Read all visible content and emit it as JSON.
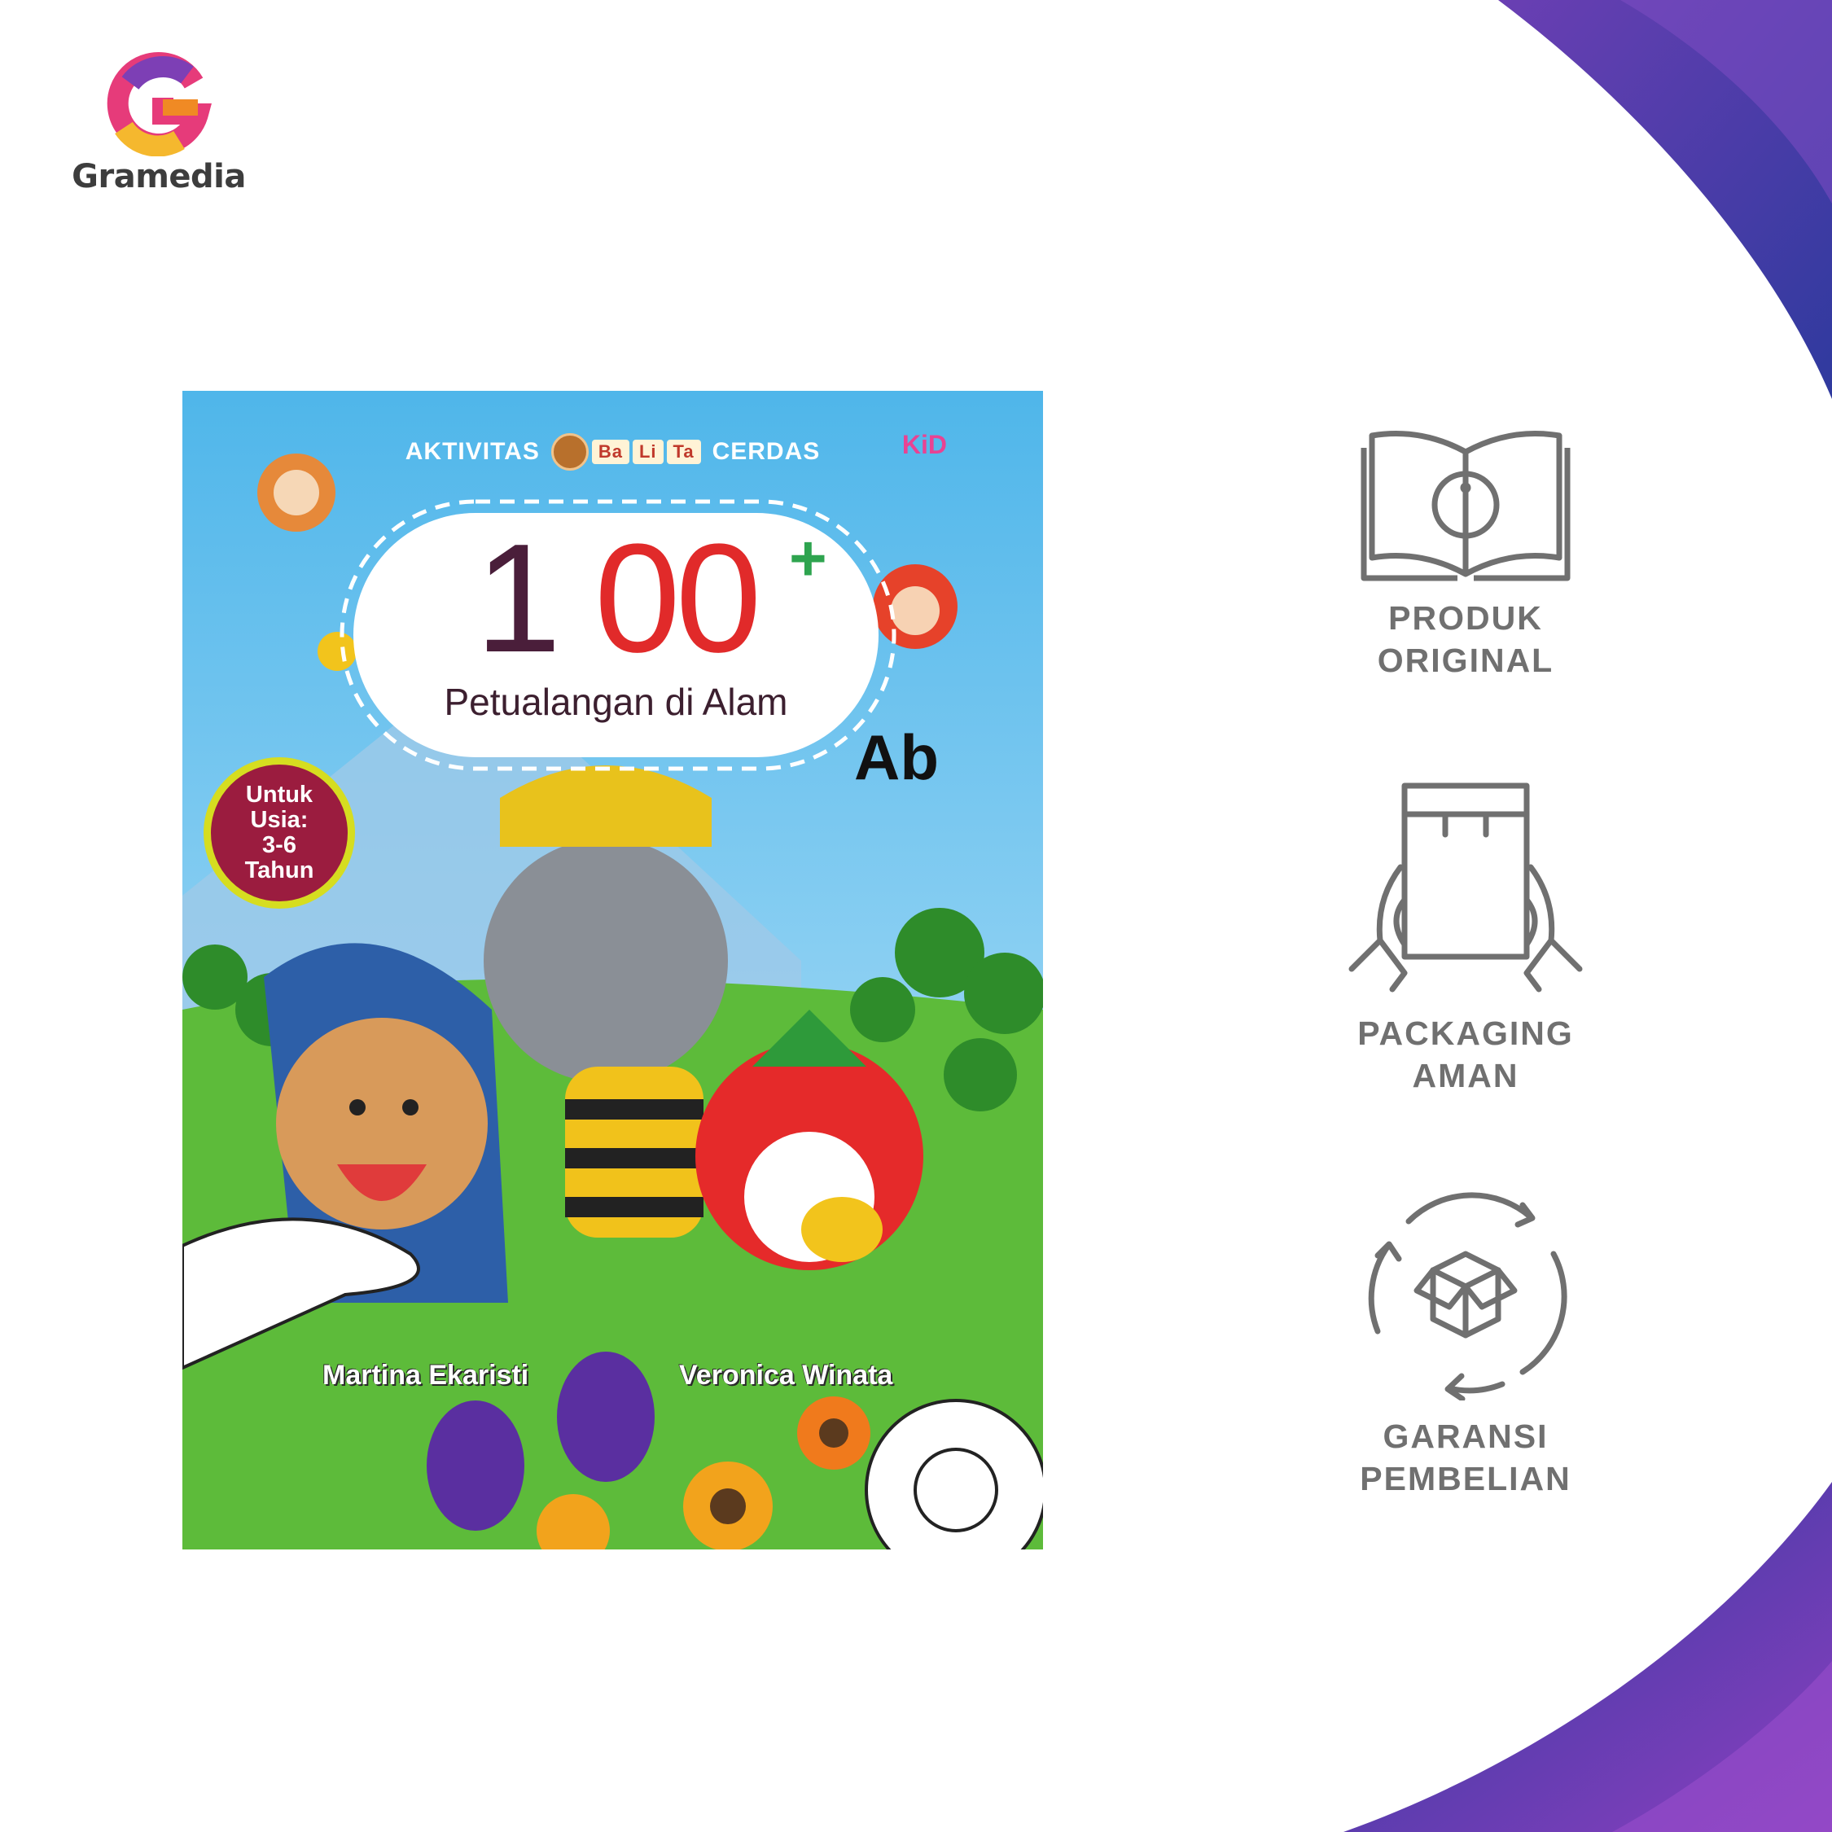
{
  "brand": {
    "name": "Gramedia"
  },
  "colors": {
    "background": "#ffffff",
    "accent_blue": "#2f3a9e",
    "accent_purple": "#7d3fb5",
    "feature_gray": "#707070"
  },
  "book": {
    "series_left": "AKTIVITAS",
    "series_badges": [
      "Ba",
      "Li",
      "Ta"
    ],
    "series_right": "CERDAS",
    "publisher": "KiD",
    "title_number": "100",
    "title_plus": "+",
    "subtitle": "Petualangan di Alam",
    "letters": "Ab",
    "age_badge": [
      "Untuk",
      "Usia:",
      "3-6",
      "Tahun"
    ],
    "authors": [
      "Martina Ekaristi",
      "Veronica Winata"
    ]
  },
  "features": [
    {
      "icon": "open-book-info-icon",
      "lines": [
        "PRODUK",
        "ORIGINAL"
      ]
    },
    {
      "icon": "hands-holding-package-icon",
      "lines": [
        "PACKAGING",
        "AMAN"
      ]
    },
    {
      "icon": "box-cycle-icon",
      "lines": [
        "GARANSI",
        "PEMBELIAN"
      ]
    }
  ]
}
